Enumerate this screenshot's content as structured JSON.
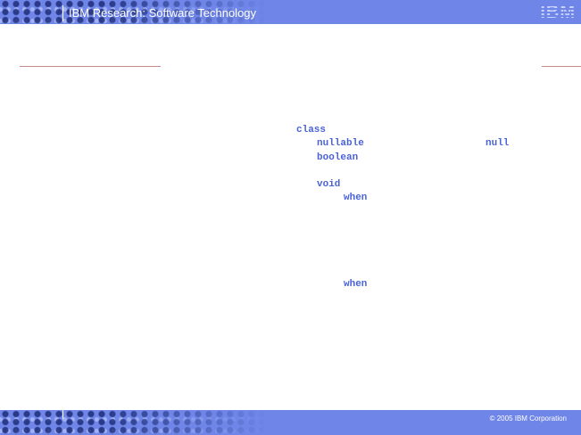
{
  "header": {
    "title": "IBM Research: Software Technology",
    "logo_text": "IBM"
  },
  "code": {
    "keywords": [
      "class",
      "nullable",
      "null",
      "boolean",
      "void",
      "when",
      "when"
    ]
  },
  "footer": {
    "copyright": "© 2005 IBM Corporation"
  },
  "colors": {
    "band": "#6f86e8",
    "keyword": "#4a63d8",
    "rule": "#c48888"
  }
}
